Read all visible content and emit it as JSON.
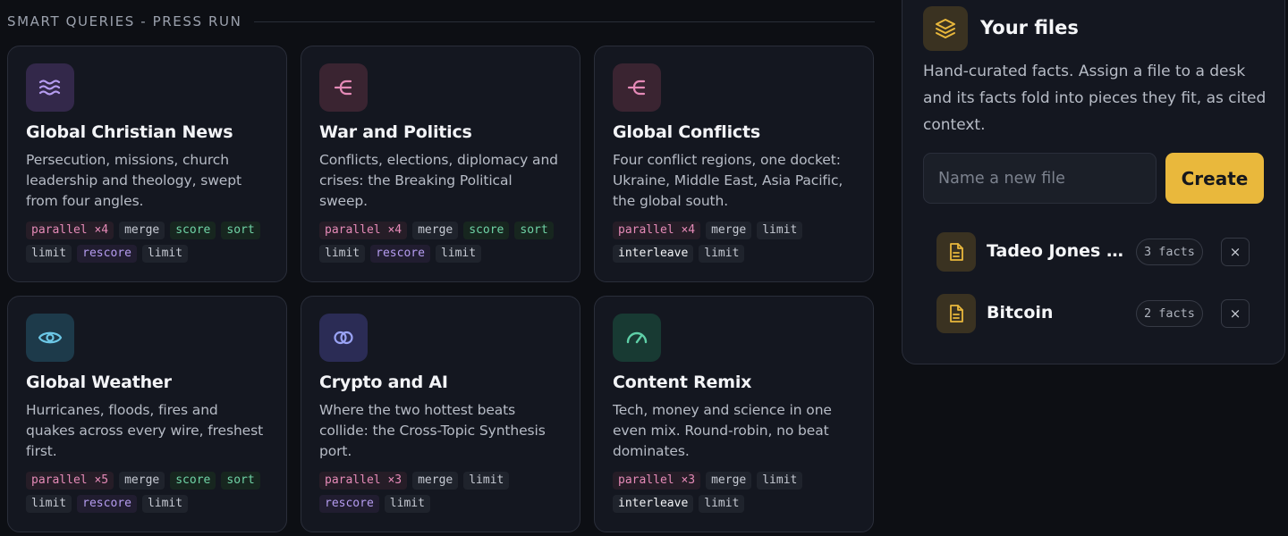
{
  "section": {
    "title": "SMART QUERIES - PRESS RUN"
  },
  "queries": [
    {
      "title": "Global Christian News",
      "description": "Persecution, missions, church leadership and theology, swept from four angles.",
      "icon": "waves-icon",
      "tags": [
        "parallel ×4",
        "merge",
        "score",
        "sort",
        "limit",
        "rescore",
        "limit"
      ]
    },
    {
      "title": "War and Politics",
      "description": "Conflicts, elections, diplomacy and crises: the Breaking Political sweep.",
      "icon": "fork-icon",
      "tags": [
        "parallel ×4",
        "merge",
        "score",
        "sort",
        "limit",
        "rescore",
        "limit"
      ]
    },
    {
      "title": "Global Conflicts",
      "description": "Four conflict regions, one docket: Ukraine, Middle East, Asia Pacific, the global south.",
      "icon": "fork-icon",
      "tags": [
        "parallel ×4",
        "merge",
        "limit",
        "interleave",
        "limit"
      ]
    },
    {
      "title": "Global Weather",
      "description": "Hurricanes, floods, fires and quakes across every wire, freshest first.",
      "icon": "eye-icon",
      "tags": [
        "parallel ×5",
        "merge",
        "score",
        "sort",
        "limit",
        "rescore",
        "limit"
      ]
    },
    {
      "title": "Crypto and AI",
      "description": "Where the two hottest beats collide: the Cross-Topic Synthesis port.",
      "icon": "rings-icon",
      "tags": [
        "parallel ×3",
        "merge",
        "limit",
        "rescore",
        "limit"
      ]
    },
    {
      "title": "Content Remix",
      "description": "Tech, money and science in one even mix. Round-robin, no beat dominates.",
      "icon": "gauge-icon",
      "tags": [
        "parallel ×3",
        "merge",
        "limit",
        "interleave",
        "limit"
      ]
    }
  ],
  "files": {
    "title": "Your files",
    "description": "Hand-curated facts. Assign a file to a desk and its facts fold into pieces they fit, as cited context.",
    "input_placeholder": "Name a new file",
    "input_value": "",
    "create_label": "Create",
    "items": [
      {
        "name": "Tadeo Jones fi...",
        "count": "3 facts",
        "remove": "×"
      },
      {
        "name": "Bitcoin",
        "count": "2 facts",
        "remove": "×"
      }
    ]
  },
  "colors": {
    "background": "#0d0f14",
    "card": "#141720",
    "accent_gold": "#e9b83c",
    "tag_pink": "#e58ab7",
    "tag_green": "#6fd3a6",
    "tag_purple": "#b59cf0"
  }
}
